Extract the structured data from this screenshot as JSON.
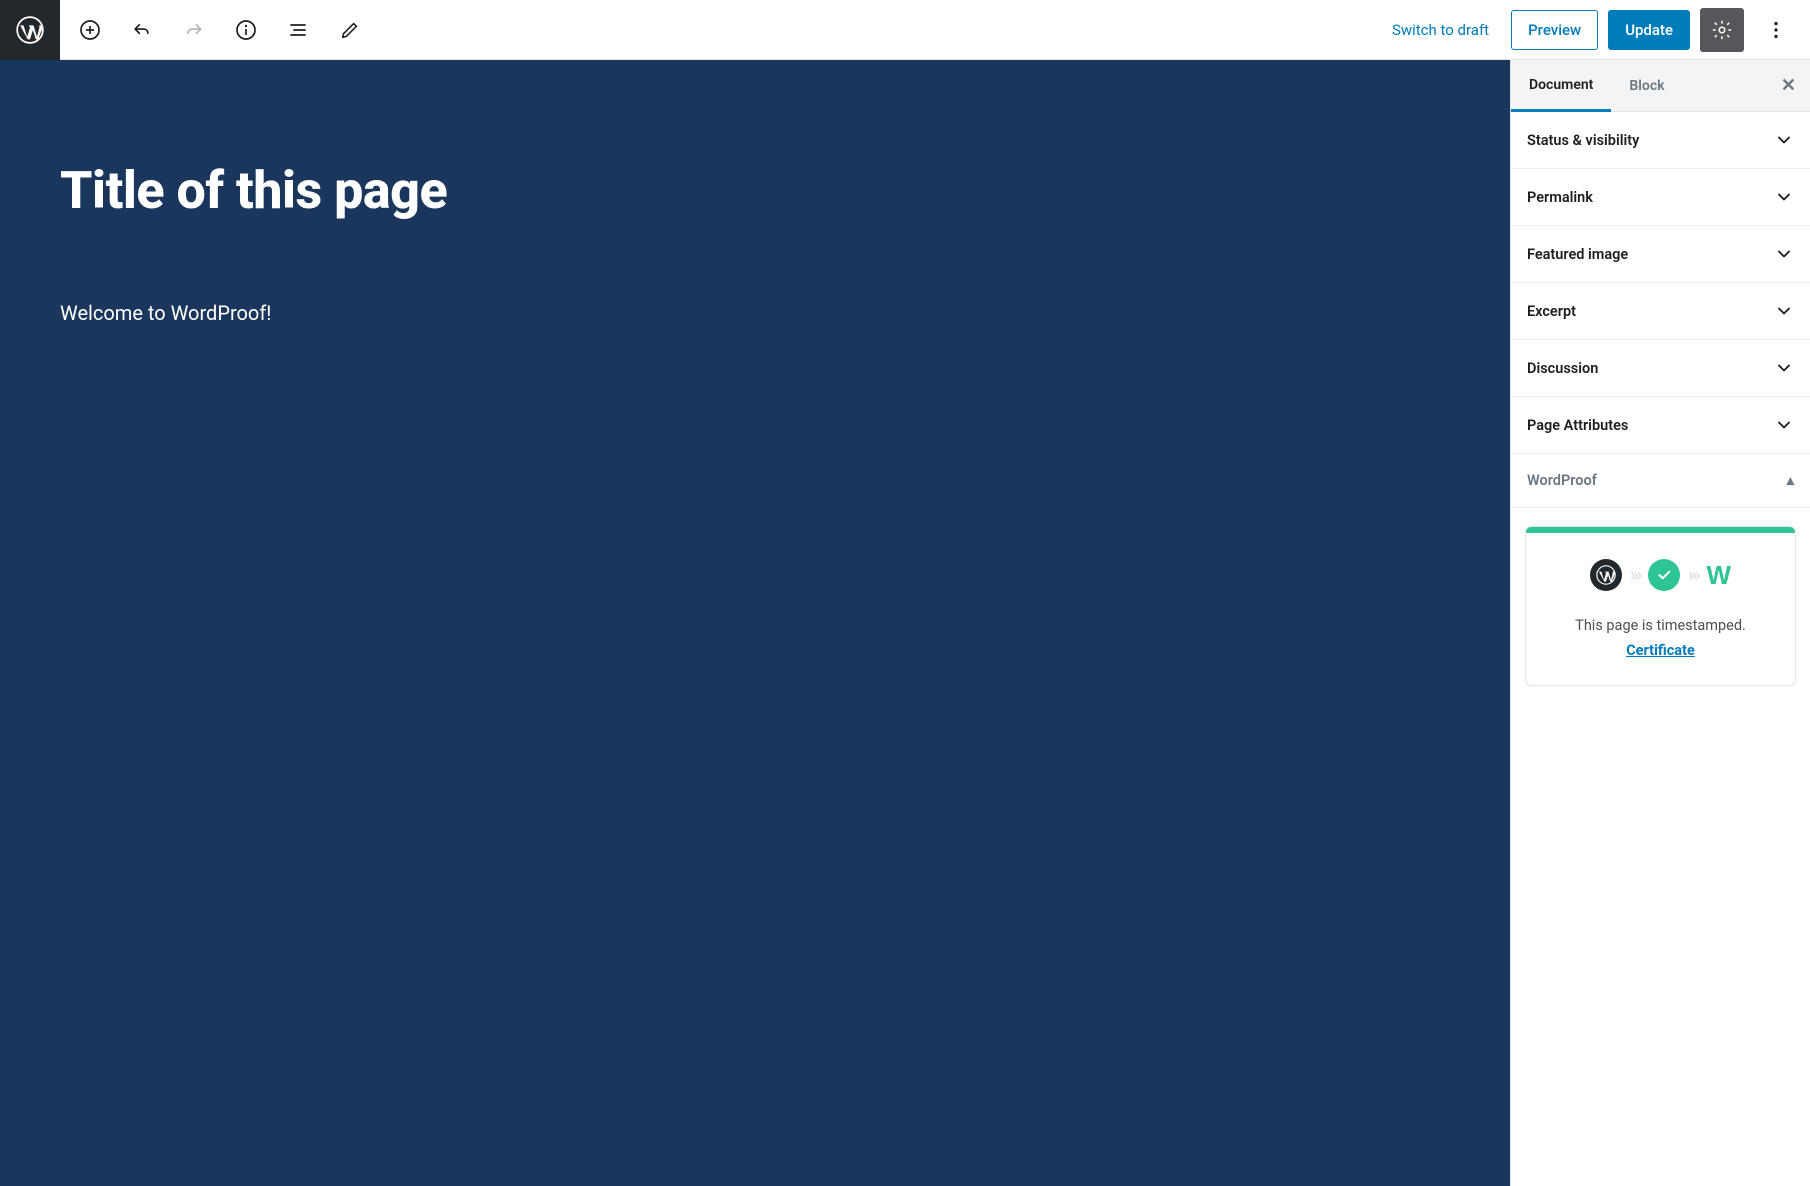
{
  "toolbar": {
    "switch_to_draft": "Switch to draft",
    "preview": "Preview",
    "update": "Update"
  },
  "editor": {
    "title": "Title of this page",
    "body": "Welcome to WordProof!"
  },
  "sidebar": {
    "tabs": {
      "document": "Document",
      "block": "Block"
    },
    "panels": {
      "status": "Status & visibility",
      "permalink": "Permalink",
      "featured_image": "Featured image",
      "excerpt": "Excerpt",
      "discussion": "Discussion",
      "page_attributes": "Page Attributes",
      "wordproof": "WordProof"
    },
    "card": {
      "text": "This page is timestamped.",
      "link": "Certificate",
      "wordproof_mark": "W"
    }
  }
}
